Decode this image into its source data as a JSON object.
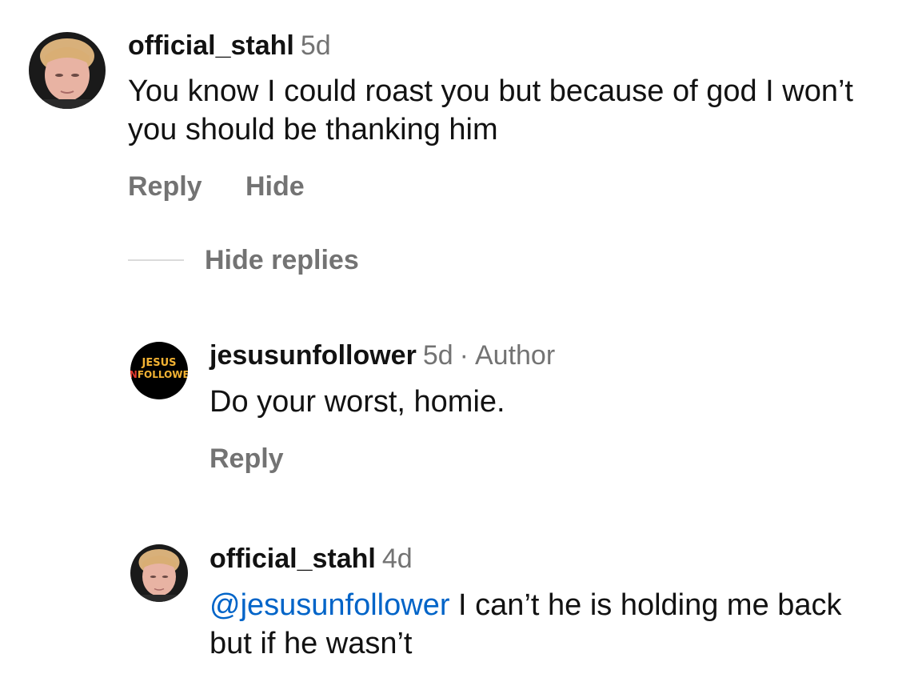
{
  "comments": [
    {
      "username": "official_stahl",
      "time": "5d",
      "text": "You know I could roast you but because of god I won’t you should be thanking him",
      "actions": {
        "reply": "Reply",
        "hide": "Hide"
      },
      "hide_replies": "Hide replies",
      "avatar_icon": "profile-photo"
    }
  ],
  "replies": [
    {
      "username": "jesusunfollower",
      "time": "5d",
      "separator": "·",
      "badge": "Author",
      "text": "Do your worst, homie.",
      "actions": {
        "reply": "Reply"
      },
      "avatar_icon": "jesus-unfollower-logo",
      "logo": {
        "line1": "JESUS",
        "line2_prefix": "UN",
        "line2_rest": "FOLLOWER"
      }
    },
    {
      "username": "official_stahl",
      "time": "4d",
      "mention": "@jesusunfollower",
      "text": " I can’t he is holding me back but if he wasn’t",
      "avatar_icon": "profile-photo"
    }
  ],
  "colors": {
    "text": "#121212",
    "secondary": "#737373",
    "mention": "#0064c8",
    "divider": "#dbdbdb"
  }
}
